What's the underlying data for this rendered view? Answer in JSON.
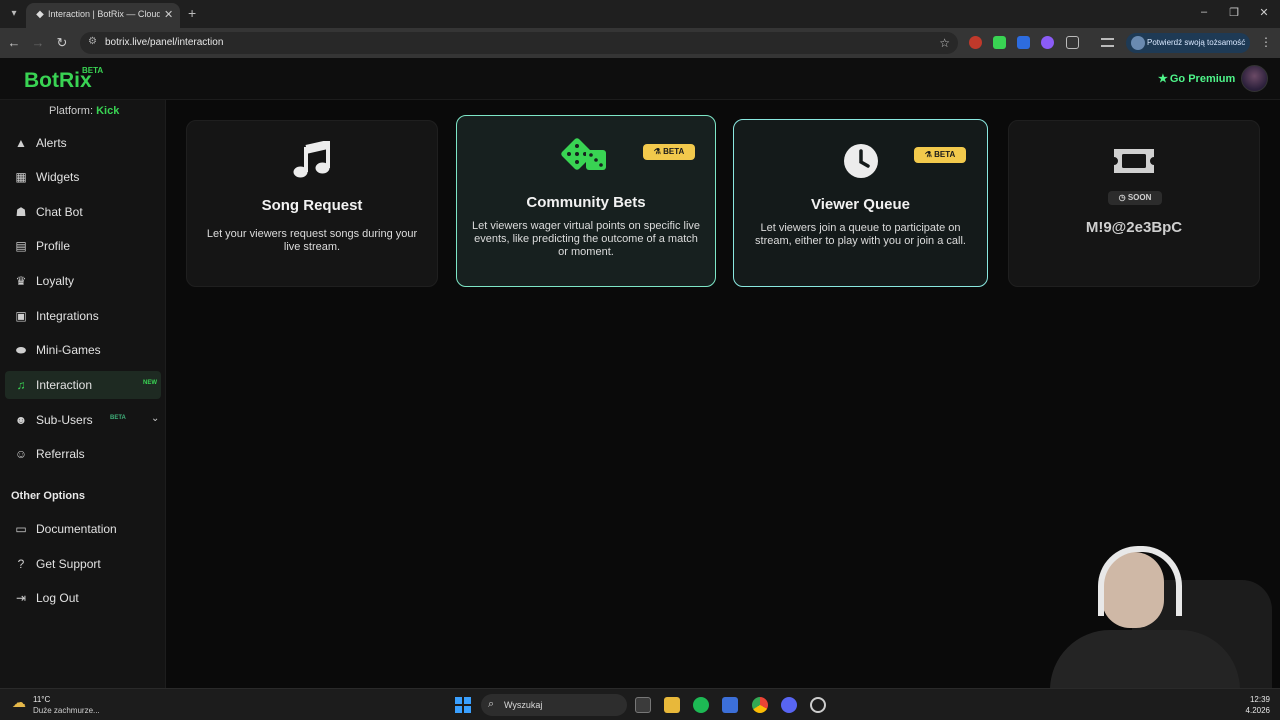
{
  "browser": {
    "tab_title": "Interaction | BotRix — Cloud St",
    "tab_close": "✕",
    "new_tab": "+",
    "url": "botrix.live/panel/interaction",
    "profile_label": "Potwierdź swoją tożsamość",
    "colors": {
      "tabbar": "#1f1f1f",
      "toolbar": "#353535"
    }
  },
  "header": {
    "logo": "BotRix",
    "logo_badge": "BETA",
    "premium_label": "Go Premium"
  },
  "sidebar": {
    "platform_label": "Platform:",
    "platform_value": "Kick",
    "items": [
      {
        "label": "Alerts",
        "icon": "warning-icon"
      },
      {
        "label": "Widgets",
        "icon": "grid-icon"
      },
      {
        "label": "Chat Bot",
        "icon": "robot-icon"
      },
      {
        "label": "Profile",
        "icon": "id-card-icon"
      },
      {
        "label": "Loyalty",
        "icon": "trophy-icon"
      },
      {
        "label": "Integrations",
        "icon": "plug-icon"
      },
      {
        "label": "Mini-Games",
        "icon": "gamepad-icon"
      },
      {
        "label": "Interaction",
        "icon": "music-icon",
        "badge": "NEW",
        "active": true
      },
      {
        "label": "Sub-Users",
        "icon": "users-icon",
        "badge": "BETA"
      },
      {
        "label": "Referrals",
        "icon": "user-group-icon"
      }
    ],
    "other_title": "Other Options",
    "other_items": [
      {
        "label": "Documentation",
        "icon": "book-icon"
      },
      {
        "label": "Get Support",
        "icon": "question-icon"
      },
      {
        "label": "Log Out",
        "icon": "logout-icon"
      }
    ]
  },
  "cards": [
    {
      "title": "Song Request",
      "description": "Let your viewers request songs during your live stream.",
      "icon": "music-note-icon"
    },
    {
      "title": "Community Bets",
      "description": "Let viewers wager virtual points on specific live events, like predicting the outcome of a match or moment.",
      "icon": "dice-icon",
      "badge": "BETA"
    },
    {
      "title": "Viewer Queue",
      "description": "Let viewers join a queue to participate on stream, either to play with you or join a call.",
      "icon": "clock-icon",
      "badge": "BETA"
    },
    {
      "title": "M!9@2e3BpC",
      "badge": "SOON",
      "icon": "ticket-icon"
    }
  ],
  "taskbar": {
    "temperature": "11°C",
    "weather": "Duże zachmurze...",
    "search_placeholder": "Wyszukaj",
    "time": "12:39",
    "date": "4.2026"
  },
  "colors": {
    "accent": "#39d353",
    "beta_badge": "#f2c94c",
    "selected_border": "#7ee6c7"
  }
}
